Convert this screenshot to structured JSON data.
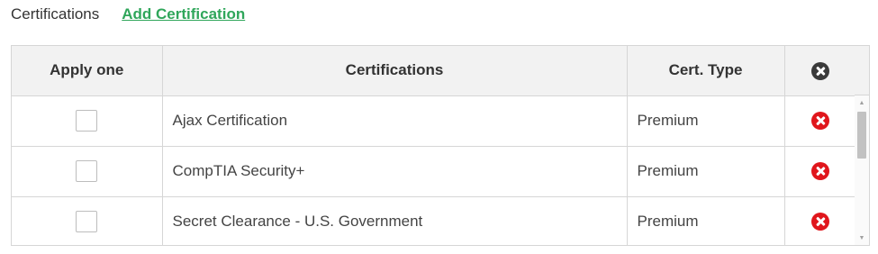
{
  "header": {
    "title": "Certifications",
    "add_link": "Add Certification"
  },
  "table": {
    "columns": {
      "apply": "Apply one",
      "certifications": "Certifications",
      "type": "Cert. Type"
    },
    "clear_all_icon": "close-circle-dark-icon",
    "rows": [
      {
        "name": "Ajax Certification",
        "type": "Premium",
        "checked": false
      },
      {
        "name": "CompTIA Security+",
        "type": "Premium",
        "checked": false
      },
      {
        "name": "Secret Clearance - U.S. Government",
        "type": "Premium",
        "checked": false
      }
    ]
  },
  "colors": {
    "link": "#2fa65a",
    "delete": "#e0161c",
    "header_bg": "#f2f2f2",
    "border": "#d6d6d6"
  }
}
